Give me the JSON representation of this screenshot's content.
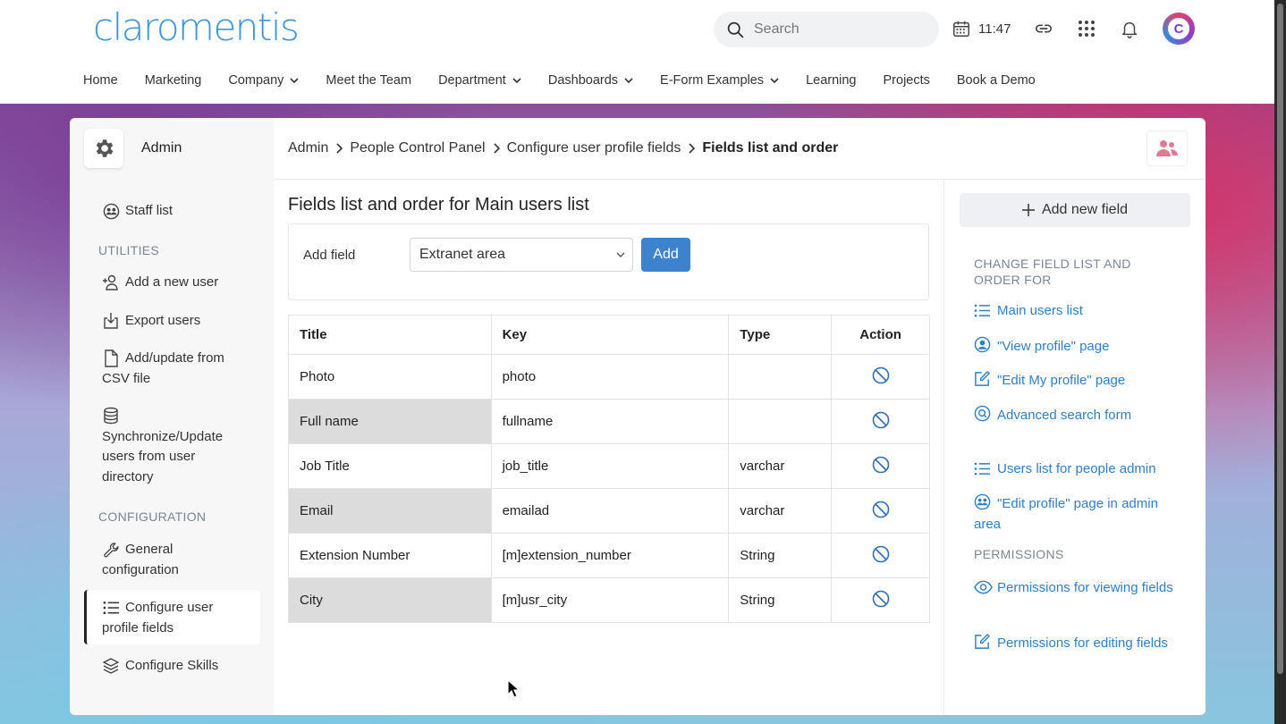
{
  "header": {
    "logo": "claromentis",
    "search_placeholder": "Search",
    "time": "11:47",
    "avatar_letter": "C"
  },
  "nav": [
    {
      "label": "Home",
      "dropdown": false
    },
    {
      "label": "Marketing",
      "dropdown": false
    },
    {
      "label": "Company",
      "dropdown": true
    },
    {
      "label": "Meet the Team",
      "dropdown": false
    },
    {
      "label": "Department",
      "dropdown": true
    },
    {
      "label": "Dashboards",
      "dropdown": true
    },
    {
      "label": "E-Form Examples",
      "dropdown": true
    },
    {
      "label": "Learning",
      "dropdown": false
    },
    {
      "label": "Projects",
      "dropdown": false
    },
    {
      "label": "Book a Demo",
      "dropdown": false
    }
  ],
  "sidebar": {
    "title": "Admin",
    "staff_list": "Staff list",
    "utilities_heading": "UTILITIES",
    "add_user": "Add a new user",
    "export_users": "Export users",
    "csv_line1": "Add/update from",
    "csv_line2": "CSV file",
    "sync_line1": "Synchronize/Update",
    "sync_line2": "users from user",
    "sync_line3": "directory",
    "configuration_heading": "CONFIGURATION",
    "general_line1": "General",
    "general_line2": "configuration",
    "profile_line1": "Configure user",
    "profile_line2": "profile fields",
    "skills": "Configure Skills"
  },
  "breadcrumb": {
    "b1": "Admin",
    "b2": "People Control Panel",
    "b3": "Configure user profile fields",
    "current": "Fields list and order"
  },
  "main": {
    "title": "Fields list and order for Main users list",
    "add_field_label": "Add field",
    "add_field_value": "Extranet area",
    "add_button": "Add",
    "columns": [
      "Title",
      "Key",
      "Type",
      "Action"
    ],
    "rows": [
      {
        "title": "Photo",
        "key": "photo",
        "type": ""
      },
      {
        "title": "Full name",
        "key": "fullname",
        "type": ""
      },
      {
        "title": "Job Title",
        "key": "job_title",
        "type": "varchar"
      },
      {
        "title": "Email",
        "key": "emailad",
        "type": "varchar"
      },
      {
        "title": "Extension Number",
        "key": "[m]extension_number",
        "type": "String"
      },
      {
        "title": "City",
        "key": "[m]usr_city",
        "type": "String"
      }
    ]
  },
  "right": {
    "add_new_field": "Add new field",
    "change_heading_1": "CHANGE FIELD LIST AND",
    "change_heading_2": "ORDER FOR",
    "main_users_list": "Main users list",
    "view_profile": "\"View profile\" page",
    "edit_my_profile": "\"Edit My profile\" page",
    "advanced_search": "Advanced search form",
    "users_list_admin": "Users list for people admin",
    "edit_profile_admin": "\"Edit profile\" page in admin area",
    "permissions_heading": "PERMISSIONS",
    "perm_viewing": "Permissions for viewing fields",
    "perm_editing": "Permissions for editing fields"
  },
  "colors": {
    "accent": "#3d82cc",
    "link": "#2e7fc6",
    "logo": "#3f95d6"
  }
}
